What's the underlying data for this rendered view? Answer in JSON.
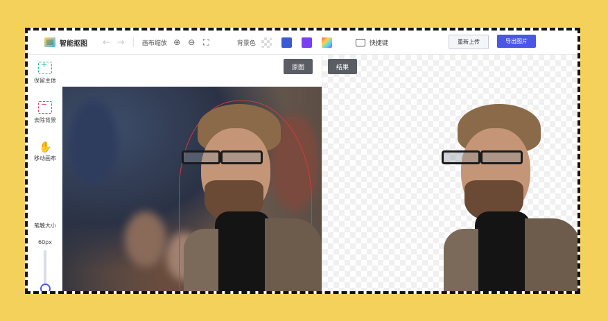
{
  "app": {
    "name": "智能抠图"
  },
  "toolbar": {
    "undo_icon": "undo-arrow-icon",
    "redo_icon": "redo-arrow-icon",
    "zoom_label": "画布缩放",
    "zoom_in_icon": "zoom-in-icon",
    "zoom_out_icon": "zoom-out-icon",
    "fit_icon": "fit-screen-icon",
    "bg_label": "背景色",
    "bg_swatches": [
      {
        "name": "transparent",
        "color": "transparent"
      },
      {
        "name": "blue",
        "color": "#3b5bd6"
      },
      {
        "name": "purple",
        "color": "#7b3ff2"
      },
      {
        "name": "gradient",
        "color": "multicolor"
      }
    ],
    "shortcut_label": "快捷键",
    "reupload_label": "重新上传",
    "export_label": "导出图片"
  },
  "sidebar": {
    "items": [
      {
        "label": "保留主体",
        "icon": "keep-subject-brush-icon"
      },
      {
        "label": "去除背景",
        "icon": "remove-background-brush-icon"
      },
      {
        "label": "移动画布",
        "icon": "hand-move-icon"
      }
    ],
    "brush": {
      "title": "笔触大小",
      "max": "60px",
      "min": "1px",
      "value_fraction": 0.0
    }
  },
  "panels": {
    "original_label": "原图",
    "result_label": "结果"
  },
  "colors": {
    "page_background": "#f3d15a",
    "accent": "#4a56e6",
    "keep": "#22b59b",
    "remove": "#e0456a",
    "outline": "#d43a3a"
  }
}
